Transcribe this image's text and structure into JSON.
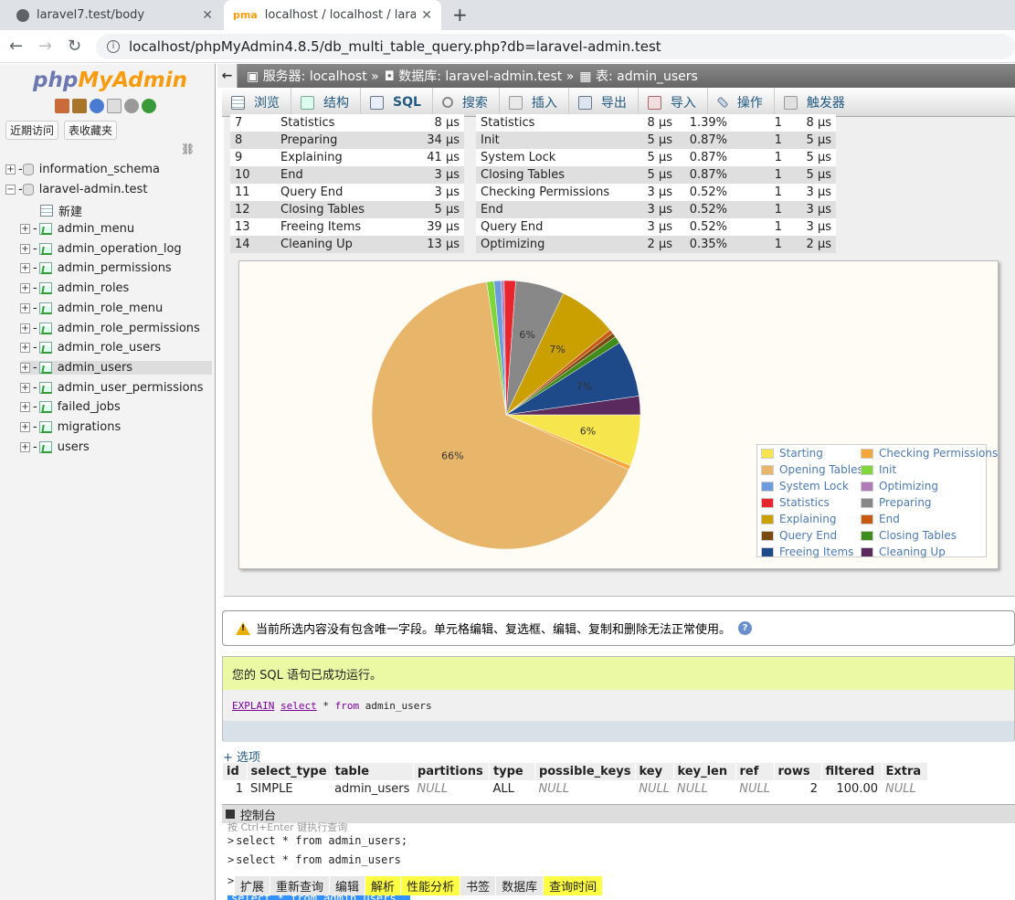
{
  "browser": {
    "tabs": [
      {
        "title": "laravel7.test/body"
      },
      {
        "title": "localhost / localhost / laravel-a"
      }
    ],
    "url": "localhost/phpMyAdmin4.8.5/db_multi_table_query.php?db=laravel-admin.test"
  },
  "sidebar": {
    "logo_php": "php",
    "logo_myadmin": "MyAdmin",
    "recent_label": "近期访问",
    "favorites_label": "表收藏夹",
    "databases": [
      {
        "name": "information_schema",
        "expanded": false
      },
      {
        "name": "laravel-admin.test",
        "expanded": true
      }
    ],
    "new_label": "新建",
    "tables": [
      "admin_menu",
      "admin_operation_log",
      "admin_permissions",
      "admin_roles",
      "admin_role_menu",
      "admin_role_permissions",
      "admin_role_users",
      "admin_users",
      "admin_user_permissions",
      "failed_jobs",
      "migrations",
      "users"
    ],
    "selected_table": "admin_users"
  },
  "breadcrumb": {
    "server": "服务器: localhost",
    "database": "数据库: laravel-admin.test",
    "table": "表: admin_users"
  },
  "menu_tabs": [
    "浏览",
    "结构",
    "SQL",
    "搜索",
    "插入",
    "导出",
    "导入",
    "操作",
    "触发器"
  ],
  "profiling": {
    "left_rows": [
      {
        "num": "7",
        "state": "Statistics",
        "time": "8 µs"
      },
      {
        "num": "8",
        "state": "Preparing",
        "time": "34 µs"
      },
      {
        "num": "9",
        "state": "Explaining",
        "time": "41 µs"
      },
      {
        "num": "10",
        "state": "End",
        "time": "3 µs"
      },
      {
        "num": "11",
        "state": "Query End",
        "time": "3 µs"
      },
      {
        "num": "12",
        "state": "Closing Tables",
        "time": "5 µs"
      },
      {
        "num": "13",
        "state": "Freeing Items",
        "time": "39 µs"
      },
      {
        "num": "14",
        "state": "Cleaning Up",
        "time": "13 µs"
      }
    ],
    "right_rows": [
      {
        "state": "Statistics",
        "total": "8 µs",
        "pct": "1.39%",
        "calls": "1",
        "avg": "8 µs"
      },
      {
        "state": "Init",
        "total": "5 µs",
        "pct": "0.87%",
        "calls": "1",
        "avg": "5 µs"
      },
      {
        "state": "System Lock",
        "total": "5 µs",
        "pct": "0.87%",
        "calls": "1",
        "avg": "5 µs"
      },
      {
        "state": "Closing Tables",
        "total": "5 µs",
        "pct": "0.87%",
        "calls": "1",
        "avg": "5 µs"
      },
      {
        "state": "Checking Permissions",
        "total": "3 µs",
        "pct": "0.52%",
        "calls": "1",
        "avg": "3 µs"
      },
      {
        "state": "End",
        "total": "3 µs",
        "pct": "0.52%",
        "calls": "1",
        "avg": "3 µs"
      },
      {
        "state": "Query End",
        "total": "3 µs",
        "pct": "0.52%",
        "calls": "1",
        "avg": "3 µs"
      },
      {
        "state": "Optimizing",
        "total": "2 µs",
        "pct": "0.35%",
        "calls": "1",
        "avg": "2 µs"
      }
    ]
  },
  "chart_data": {
    "type": "pie",
    "title": "",
    "series": [
      {
        "name": "Starting",
        "value": 6.2,
        "color": "#f6e54d"
      },
      {
        "name": "Checking Permissions",
        "value": 0.52,
        "color": "#f4a63a"
      },
      {
        "name": "Opening Tables",
        "value": 66.3,
        "color": "#e8b66a"
      },
      {
        "name": "Init",
        "value": 0.87,
        "color": "#7ed63a"
      },
      {
        "name": "System Lock",
        "value": 0.87,
        "color": "#6d9bdc"
      },
      {
        "name": "Optimizing",
        "value": 0.35,
        "color": "#b07ab5"
      },
      {
        "name": "Statistics",
        "value": 1.39,
        "color": "#e8262d"
      },
      {
        "name": "Preparing",
        "value": 5.9,
        "color": "#888888"
      },
      {
        "name": "Explaining",
        "value": 7.1,
        "color": "#c9a000"
      },
      {
        "name": "End",
        "value": 0.52,
        "color": "#c75a10"
      },
      {
        "name": "Query End",
        "value": 0.52,
        "color": "#7a4a10"
      },
      {
        "name": "Closing Tables",
        "value": 0.87,
        "color": "#3f8c1a"
      },
      {
        "name": "Freeing Items",
        "value": 6.8,
        "color": "#1e4a8a"
      },
      {
        "name": "Cleaning Up",
        "value": 2.25,
        "color": "#5a2a5e"
      }
    ],
    "labels": [
      "6%",
      "7%",
      "7%",
      "6%",
      "66%"
    ],
    "legend_placement": "bottom-right"
  },
  "warning": "当前所选内容没有包含唯一字段。单元格编辑、复选框、编辑、复制和删除无法正常使用。",
  "success": "您的 SQL 语句已成功运行。",
  "sql": {
    "explain": "EXPLAIN",
    "select": "select",
    "rest": " * ",
    "from": "from",
    "table": " admin_users"
  },
  "options_link": "+ 选项",
  "explain_table": {
    "headers": [
      "id",
      "select_type",
      "table",
      "partitions",
      "type",
      "possible_keys",
      "key",
      "key_len",
      "ref",
      "rows",
      "filtered",
      "Extra"
    ],
    "row": [
      "1",
      "SIMPLE",
      "admin_users",
      "NULL",
      "ALL",
      "NULL",
      "NULL",
      "NULL",
      "NULL",
      "2",
      "100.00",
      "NULL"
    ]
  },
  "console": {
    "title": "控制台",
    "faded": "按 Ctrl+Enter 键执行查询",
    "history": [
      "select * from admin_users;",
      "select * from admin_users"
    ],
    "toolbar": [
      "扩展",
      "重新查询",
      "编辑",
      "解析",
      "性能分析",
      "书签",
      "数据库",
      "查询时间"
    ],
    "selected": "select * from admin_users"
  }
}
